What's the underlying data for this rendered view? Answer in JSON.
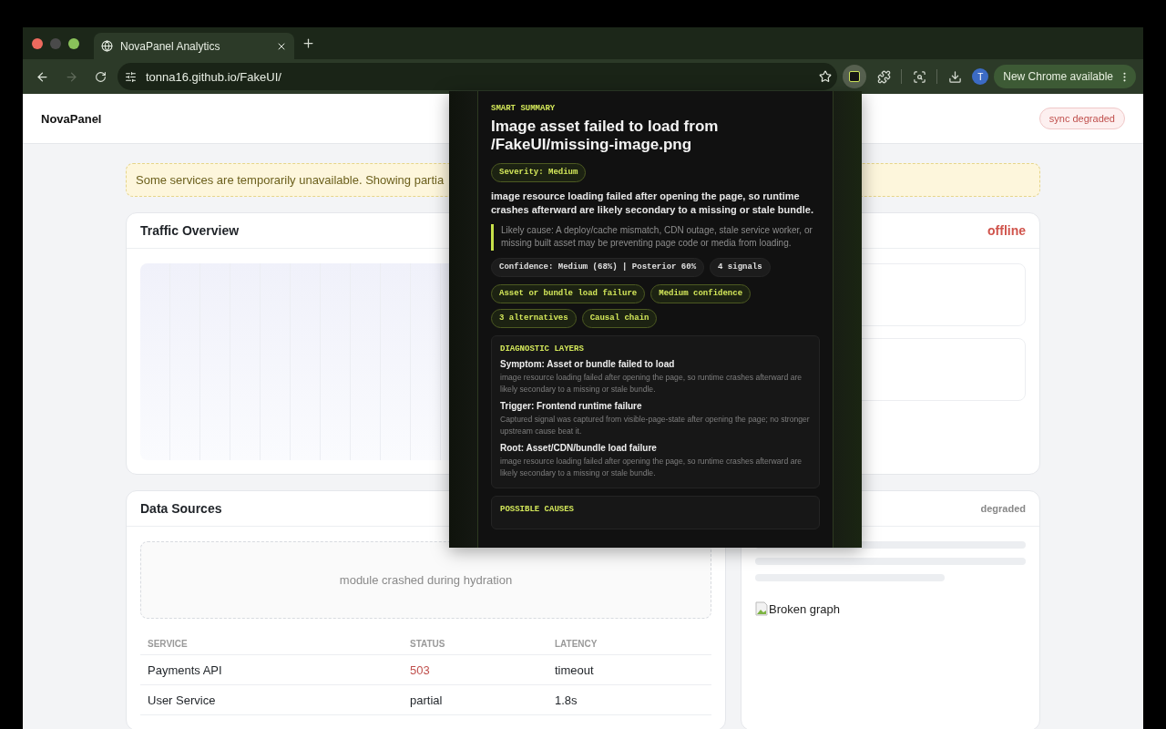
{
  "browser": {
    "tab_title": "NovaPanel Analytics",
    "url": "tonna16.github.io/FakeUI/",
    "nav": [
      {
        "kind": "back",
        "disabled": false
      },
      {
        "kind": "forward",
        "disabled": true
      },
      {
        "kind": "reload",
        "disabled": false
      }
    ],
    "profile_initial": "T",
    "update_button": "New Chrome available"
  },
  "header": {
    "brand": "NovaPanel",
    "status_badge": "sync degraded"
  },
  "banner": "Some services are temporarily unavailable. Showing partia",
  "traffic": {
    "title": "Traffic Overview",
    "status": "offline"
  },
  "data_sources": {
    "title": "Data Sources",
    "error_message": "module crashed during hydration",
    "columns": [
      "SERVICE",
      "STATUS",
      "LATENCY"
    ],
    "rows": [
      {
        "service": "Payments API",
        "status": "503",
        "color": "#c0504d",
        "latency": "timeout"
      },
      {
        "service": "User Service",
        "status": "partial",
        "color": "#1f2328",
        "latency": "1.8s"
      }
    ]
  },
  "side_card": {
    "status": "degraded",
    "image_alt": "Broken graph"
  },
  "popup": {
    "eyebrow": "SMART SUMMARY",
    "title": "Image asset failed to load from /FakeUI/missing-image.png",
    "severity": "Severity: Medium",
    "summary": "image resource loading failed after opening the page, so runtime crashes afterward are likely secondary to a missing or stale bundle.",
    "likely_cause": "Likely cause: A deploy/cache mismatch, CDN outage, stale service worker, or missing built asset may be preventing page code or media from loading.",
    "chips": [
      {
        "label": "Confidence: Medium (68%) | Posterior 60%",
        "kind": "neutral"
      },
      {
        "label": "4 signals",
        "kind": "neutral"
      },
      {
        "label": "Asset or bundle load failure",
        "kind": "accent"
      },
      {
        "label": "Medium confidence",
        "kind": "accent"
      },
      {
        "label": "3 alternatives",
        "kind": "accent"
      },
      {
        "label": "Causal chain",
        "kind": "accent"
      }
    ],
    "diagnostic": {
      "heading": "DIAGNOSTIC LAYERS",
      "layers": [
        {
          "title": "Symptom: Asset or bundle failed to load",
          "detail": "image resource loading failed after opening the page, so runtime crashes afterward are likely secondary to a missing or stale bundle."
        },
        {
          "title": "Trigger: Frontend runtime failure",
          "detail": "Captured signal was captured from visible-page-state after opening the page; no stronger upstream cause beat it."
        },
        {
          "title": "Root: Asset/CDN/bundle load failure",
          "detail": "image resource loading failed after opening the page, so runtime crashes afterward are likely secondary to a missing or stale bundle."
        }
      ]
    },
    "next_section": "POSSIBLE CAUSES"
  }
}
